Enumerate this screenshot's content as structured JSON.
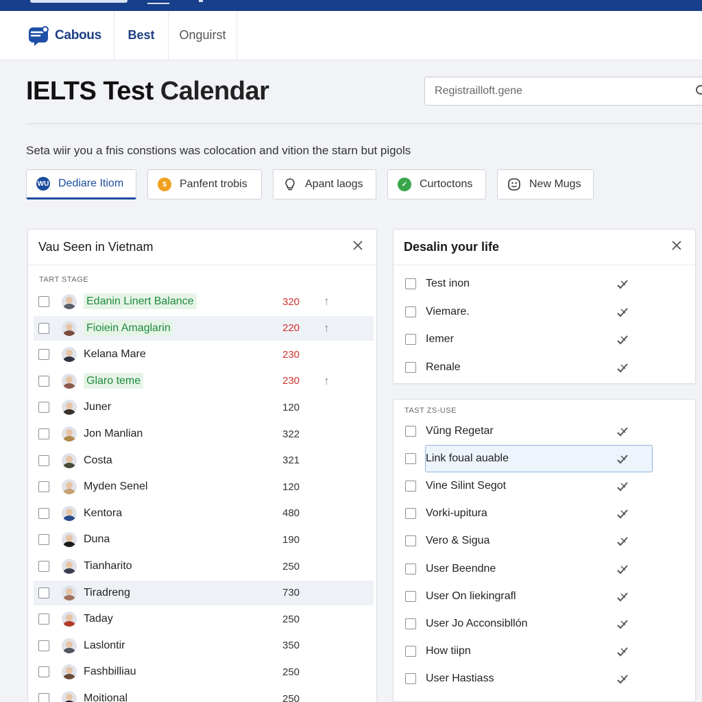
{
  "nav": {
    "brand": "Cabous",
    "items": [
      "Best",
      "Onguirst"
    ]
  },
  "page": {
    "title_bold": "IELTS Test",
    "title_rest": " Calendar",
    "search_placeholder": "Registrailloft.gene",
    "subtitle": "Seta wiir you a fnis constions was colocation and vition the starn but pigols"
  },
  "tabs": [
    {
      "label": "Dediare Itiom",
      "icon": "wu-badge-icon",
      "icon_text": "WU",
      "color": "#1d4d9e"
    },
    {
      "label": "Panfent trobis",
      "icon": "dollar-coin-icon",
      "icon_text": "$",
      "color": "#f0a020"
    },
    {
      "label": "Apant laogs",
      "icon": "lightbulb-icon",
      "icon_text": "",
      "color": "#333333"
    },
    {
      "label": "Curtoctons",
      "icon": "check-circle-icon",
      "icon_text": "✓",
      "color": "#3aa64b"
    },
    {
      "label": "New Mugs",
      "icon": "smiley-icon",
      "icon_text": "",
      "color": "#333333"
    }
  ],
  "left_panel": {
    "title": "Vau Seen in Vietnam",
    "section_label": "TART STAGE",
    "rows": [
      {
        "name": "Edanin Linert Balance",
        "value": "320",
        "tag": true,
        "red": true,
        "arrow": "↑",
        "hl": false,
        "avatar_color": "#5a5f6a"
      },
      {
        "name": "Fioiein Amaglarin",
        "value": "220",
        "tag": true,
        "red": true,
        "arrow": "↑",
        "hl": true,
        "avatar_color": "#7a4a3a"
      },
      {
        "name": "Kelana Mare",
        "value": "230",
        "tag": false,
        "red": true,
        "arrow": "",
        "hl": false,
        "avatar_color": "#2f3440"
      },
      {
        "name": "Glaro teme",
        "value": "230",
        "tag": true,
        "red": true,
        "arrow": "↑",
        "hl": false,
        "avatar_color": "#8a5a4a"
      },
      {
        "name": "Juner",
        "value": "120",
        "tag": false,
        "red": false,
        "arrow": "",
        "hl": false,
        "avatar_color": "#3a2f2a"
      },
      {
        "name": "Jon Manlian",
        "value": "322",
        "tag": false,
        "red": false,
        "arrow": "",
        "hl": false,
        "avatar_color": "#b08a4a"
      },
      {
        "name": "Costa",
        "value": "321",
        "tag": false,
        "red": false,
        "arrow": "",
        "hl": false,
        "avatar_color": "#4a4a3a"
      },
      {
        "name": "Myden Senel",
        "value": "120",
        "tag": false,
        "red": false,
        "arrow": "",
        "hl": false,
        "avatar_color": "#c8a070"
      },
      {
        "name": "Kentora",
        "value": "480",
        "tag": false,
        "red": false,
        "arrow": "",
        "hl": false,
        "avatar_color": "#2a4a8a"
      },
      {
        "name": "Duna",
        "value": "190",
        "tag": false,
        "red": false,
        "arrow": "",
        "hl": false,
        "avatar_color": "#1a1a1a"
      },
      {
        "name": "Tianharito",
        "value": "250",
        "tag": false,
        "red": false,
        "arrow": "",
        "hl": false,
        "avatar_color": "#3a3f50"
      },
      {
        "name": "Tiradreng",
        "value": "730",
        "tag": false,
        "red": false,
        "arrow": "",
        "hl": true,
        "avatar_color": "#a07060"
      },
      {
        "name": "Taday",
        "value": "250",
        "tag": false,
        "red": false,
        "arrow": "",
        "hl": false,
        "avatar_color": "#b03a2a"
      },
      {
        "name": "Laslontir",
        "value": "350",
        "tag": false,
        "red": false,
        "arrow": "",
        "hl": false,
        "avatar_color": "#505560"
      },
      {
        "name": "Fashbilliau",
        "value": "250",
        "tag": false,
        "red": false,
        "arrow": "",
        "hl": false,
        "avatar_color": "#6a4a3a"
      },
      {
        "name": "Moitional",
        "value": "250",
        "tag": false,
        "red": false,
        "arrow": "",
        "hl": false,
        "avatar_color": "#1a1a1a"
      }
    ]
  },
  "right_panel_1": {
    "title": "Desalin your life",
    "rows": [
      "Test inon",
      "Viemare.",
      "Iemer",
      "Renale"
    ]
  },
  "right_panel_2": {
    "section_label": "TAST ZS-USE",
    "rows": [
      "Vŭng Regetar",
      "Link foual auable",
      "Vine Silint Segot",
      "Vorki-upitura",
      "Vero & Sigua",
      "User Beendne",
      "User On liekingrafl",
      "User Jo Acconsibllón",
      "How tiipn",
      "User Hastiass"
    ],
    "focused_index": 1
  }
}
